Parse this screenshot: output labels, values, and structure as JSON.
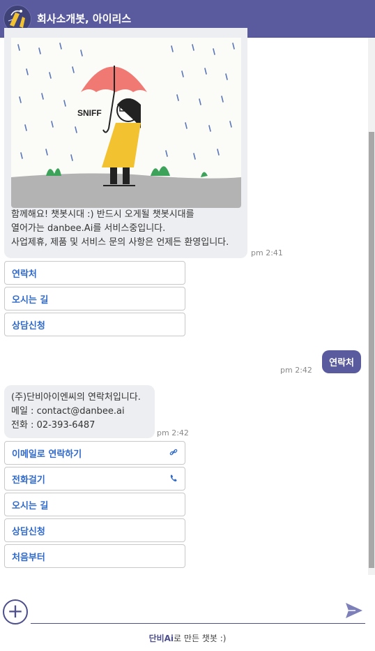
{
  "header": {
    "title": "회사소개봇, 아이리스",
    "avatar_icon": "umbrella-character-avatar"
  },
  "messages": {
    "intro": {
      "illustration_text": "SNIFF",
      "lines": [
        "함께해요! 챗봇시대 :) 반드시 오게될 챗봇시대를",
        "열어가는 danbee.Ai를 서비스중입니다.",
        "사업제휴, 제품 및 서비스 문의 사항은 언제든 환영입니다."
      ],
      "time": "pm 2:41",
      "quick_replies": [
        "연락처",
        "오시는 길",
        "상담신청"
      ]
    },
    "user": {
      "text": "연락처",
      "time": "pm 2:42"
    },
    "contact": {
      "lines": [
        "(주)단비아이엔씨의 연락처입니다.",
        "메일 : contact@danbee.ai",
        "전화 : 02-393-6487"
      ],
      "time": "pm 2:42",
      "quick_replies": [
        {
          "label": "이메일로 연락하기",
          "icon": "link-icon"
        },
        {
          "label": "전화걸기",
          "icon": "phone-icon"
        },
        {
          "label": "오시는 길",
          "icon": ""
        },
        {
          "label": "상담신청",
          "icon": ""
        },
        {
          "label": "처음부터",
          "icon": ""
        }
      ]
    }
  },
  "input": {
    "plus_icon": "plus-icon",
    "send_icon": "send-icon"
  },
  "footer": {
    "brand": "단비Ai",
    "suffix": "로 만든 챗봇 :)"
  },
  "colors": {
    "primary": "#5a5a9e",
    "bubble": "#eceef1",
    "link": "#2f69c9"
  }
}
